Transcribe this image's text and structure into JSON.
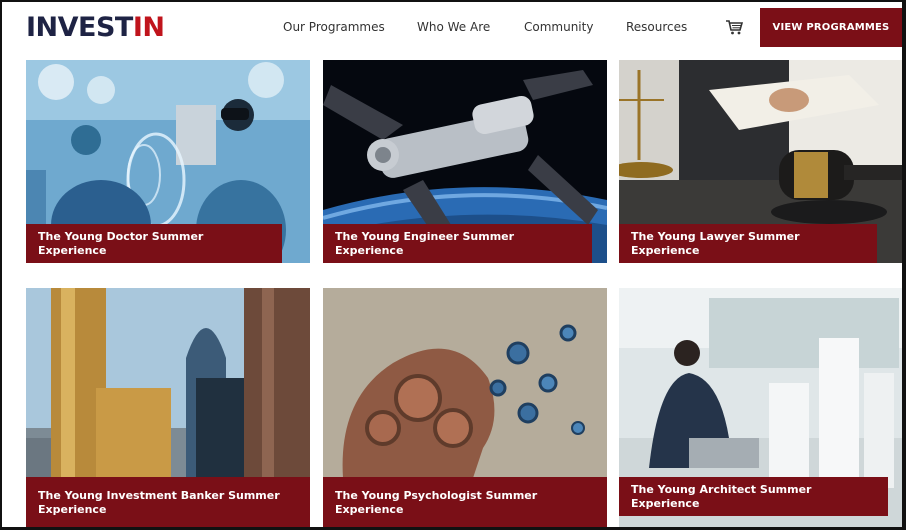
{
  "brand": {
    "logo_main": "INVEST",
    "logo_accent": "IN"
  },
  "nav": {
    "items": [
      "Our Programmes",
      "Who We Are",
      "Community",
      "Resources"
    ],
    "cart_icon": "cart-icon",
    "cta_label": "VIEW PROGRAMMES"
  },
  "colors": {
    "brand_red": "#7b0f17",
    "logo_navy": "#1e2344",
    "logo_red": "#c0141c"
  },
  "programmes": [
    {
      "title": "The Young Doctor Summer Experience",
      "image": "surgeons-vr-image"
    },
    {
      "title": "The Young Engineer Summer Experience",
      "image": "space-station-image"
    },
    {
      "title": "The Young Lawyer Summer Experience",
      "image": "gavel-book-image"
    },
    {
      "title": "The Young Investment Banker Summer Experience",
      "image": "city-skyscrapers-image"
    },
    {
      "title": "The Young Psychologist Summer Experience",
      "image": "gears-head-image"
    },
    {
      "title": "The Young Architect Summer Experience",
      "image": "architect-office-image"
    }
  ]
}
